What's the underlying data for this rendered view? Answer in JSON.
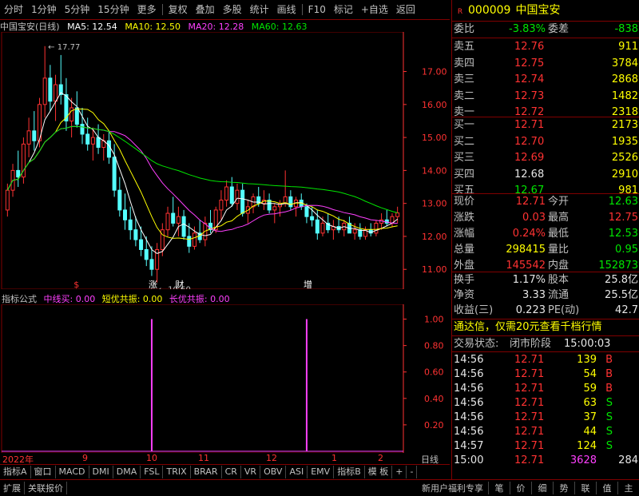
{
  "toolbar": {
    "items": [
      "分时",
      "1分钟",
      "5分钟",
      "15分钟",
      "更多",
      "复权",
      "叠加",
      "多股",
      "统计",
      "画线",
      "F10",
      "标记",
      "+自选",
      "返回"
    ]
  },
  "header": {
    "stock_title": "中国宝安(日线)",
    "ma5": "MA5: 12.54",
    "ma10": "MA10: 12.50",
    "ma20": "MA20: 12.28",
    "ma60": "MA60: 12.63",
    "high_label": "17.77",
    "low_label": "10.60"
  },
  "colors": {
    "up": "#ff3232",
    "down": "#54ffff",
    "ma5": "#ffffff",
    "ma10": "#ffff00",
    "ma20": "#ff40ff",
    "ma60": "#00e600",
    "axis": "#ff3232",
    "grid": "#800000"
  },
  "event_marks": [
    {
      "text": "$",
      "color": "#ff3232"
    },
    {
      "text": "涨",
      "color": "#ffffff"
    },
    {
      "text": "财",
      "color": "#ffffff"
    },
    {
      "text": "增",
      "color": "#ffffff"
    }
  ],
  "indicator": {
    "name": "指标公式",
    "line1": "中线买: 0.00",
    "line2": "短优共振: 0.00",
    "line3": "长优共振: 0.00"
  },
  "dates": [
    "2022年",
    "9",
    "10",
    "11",
    "12",
    "1",
    "2"
  ],
  "period_label": "日线",
  "tabs": [
    "指标A",
    "窗口",
    "MACD",
    "DMI",
    "DMA",
    "FSL",
    "TRIX",
    "BRAR",
    "CR",
    "VR",
    "OBV",
    "ASI",
    "EMV",
    "指标B",
    "模 板",
    "+",
    "-"
  ],
  "bottom": {
    "left": [
      "扩展",
      "关联报价"
    ],
    "center": "新用户福利专享",
    "right": [
      "笔",
      "价",
      "细",
      "势",
      "联",
      "值",
      "主"
    ]
  },
  "chart_data": [
    {
      "type": "candlestick",
      "title": "中国宝安(日线)",
      "ylim": [
        10.4,
        18.2
      ],
      "y_ticks": [
        11.0,
        12.0,
        13.0,
        14.0,
        15.0,
        16.0,
        17.0
      ],
      "series_ma": [
        {
          "name": "MA5",
          "value": 12.54
        },
        {
          "name": "MA10",
          "value": 12.5
        },
        {
          "name": "MA20",
          "value": 12.28
        },
        {
          "name": "MA60",
          "value": 12.63
        }
      ],
      "candles": [
        [
          12.8,
          13.6,
          12.6,
          13.4
        ],
        [
          13.4,
          14.2,
          13.2,
          14.0
        ],
        [
          14.0,
          14.6,
          13.5,
          13.8
        ],
        [
          13.8,
          15.0,
          13.6,
          14.8
        ],
        [
          14.8,
          15.6,
          14.4,
          15.2
        ],
        [
          15.2,
          15.8,
          14.6,
          14.9
        ],
        [
          14.9,
          16.2,
          14.7,
          16.0
        ],
        [
          16.0,
          17.77,
          15.6,
          16.8
        ],
        [
          16.8,
          17.2,
          15.8,
          16.1
        ],
        [
          16.1,
          16.9,
          15.5,
          16.6
        ],
        [
          16.6,
          17.5,
          16.0,
          16.3
        ],
        [
          16.3,
          16.8,
          15.2,
          15.5
        ],
        [
          15.5,
          16.2,
          15.0,
          15.9
        ],
        [
          15.9,
          16.4,
          15.3,
          15.4
        ],
        [
          15.4,
          15.9,
          14.8,
          15.1
        ],
        [
          15.1,
          15.6,
          14.6,
          14.8
        ],
        [
          14.8,
          15.3,
          14.3,
          15.0
        ],
        [
          15.0,
          15.4,
          14.5,
          14.7
        ],
        [
          14.7,
          15.1,
          14.3,
          14.9
        ],
        [
          14.9,
          15.2,
          14.2,
          14.4
        ],
        [
          14.4,
          14.8,
          13.2,
          13.4
        ],
        [
          13.4,
          13.8,
          12.6,
          12.8
        ],
        [
          12.8,
          13.3,
          12.2,
          12.5
        ],
        [
          12.5,
          12.9,
          11.9,
          12.2
        ],
        [
          12.2,
          12.6,
          11.7,
          11.9
        ],
        [
          11.9,
          12.3,
          11.4,
          11.6
        ],
        [
          11.6,
          12.0,
          11.1,
          11.3
        ],
        [
          11.3,
          11.7,
          10.8,
          11.0
        ],
        [
          11.0,
          11.8,
          10.6,
          11.6
        ],
        [
          11.6,
          12.4,
          11.4,
          12.2
        ],
        [
          12.2,
          12.9,
          12.0,
          12.7
        ],
        [
          12.7,
          13.2,
          12.3,
          12.4
        ],
        [
          12.4,
          12.9,
          12.0,
          12.6
        ],
        [
          12.6,
          12.8,
          11.9,
          12.0
        ],
        [
          12.0,
          12.4,
          11.5,
          11.7
        ],
        [
          11.7,
          12.3,
          11.6,
          12.1
        ],
        [
          12.1,
          12.5,
          11.8,
          11.9
        ],
        [
          11.9,
          12.6,
          11.7,
          12.4
        ],
        [
          12.4,
          12.8,
          12.1,
          12.2
        ],
        [
          12.2,
          12.9,
          12.1,
          12.8
        ],
        [
          12.8,
          13.4,
          12.5,
          13.1
        ],
        [
          13.1,
          13.7,
          12.9,
          13.5
        ],
        [
          13.5,
          13.8,
          12.9,
          13.0
        ],
        [
          13.0,
          13.6,
          12.8,
          13.4
        ],
        [
          13.4,
          13.6,
          12.6,
          12.7
        ],
        [
          12.7,
          13.1,
          12.4,
          12.9
        ],
        [
          12.9,
          13.3,
          12.7,
          13.2
        ],
        [
          13.2,
          13.5,
          12.9,
          13.0
        ],
        [
          13.0,
          13.4,
          12.8,
          13.1
        ],
        [
          13.1,
          13.3,
          12.7,
          12.8
        ],
        [
          12.8,
          13.0,
          12.4,
          12.9
        ],
        [
          12.9,
          13.1,
          12.6,
          13.0
        ],
        [
          13.0,
          14.0,
          12.9,
          13.2
        ],
        [
          13.2,
          13.4,
          12.8,
          12.9
        ],
        [
          12.9,
          13.2,
          12.6,
          13.1
        ],
        [
          13.1,
          13.3,
          12.8,
          12.9
        ],
        [
          12.9,
          13.0,
          12.4,
          12.6
        ],
        [
          12.6,
          12.9,
          12.3,
          12.5
        ],
        [
          12.5,
          12.8,
          11.9,
          12.1
        ],
        [
          12.1,
          12.6,
          12.0,
          12.4
        ],
        [
          12.4,
          12.7,
          12.1,
          12.2
        ],
        [
          12.2,
          12.5,
          11.9,
          12.3
        ],
        [
          12.3,
          12.6,
          12.1,
          12.2
        ],
        [
          12.2,
          12.5,
          12.0,
          12.4
        ],
        [
          12.4,
          12.6,
          12.1,
          12.1
        ],
        [
          12.1,
          12.4,
          11.9,
          12.2
        ],
        [
          12.2,
          12.4,
          11.9,
          12.0
        ],
        [
          12.0,
          12.3,
          11.9,
          12.2
        ],
        [
          12.2,
          12.4,
          12.0,
          12.1
        ],
        [
          12.1,
          12.5,
          12.0,
          12.4
        ],
        [
          12.4,
          12.7,
          12.2,
          12.5
        ],
        [
          12.5,
          12.8,
          12.3,
          12.4
        ],
        [
          12.4,
          12.7,
          12.3,
          12.6
        ],
        [
          12.6,
          12.9,
          12.4,
          12.71
        ]
      ]
    },
    {
      "type": "line",
      "title": "指标公式",
      "ylim": [
        0,
        1.1
      ],
      "y_ticks": [
        0.2,
        0.4,
        0.6,
        0.8,
        1.0
      ],
      "spikes_at_index": [
        27,
        56
      ],
      "spike_value": 1.0,
      "color": "#ff40ff"
    }
  ],
  "quote": {
    "code": "000009",
    "name": "中国宝安",
    "weibi_label": "委比",
    "weibi": "-3.83%",
    "weicha_label": "委差",
    "weicha": "-838",
    "asks": [
      {
        "label": "卖五",
        "price": "12.76",
        "vol": "911"
      },
      {
        "label": "卖四",
        "price": "12.75",
        "vol": "3784"
      },
      {
        "label": "卖三",
        "price": "12.74",
        "vol": "2868"
      },
      {
        "label": "卖二",
        "price": "12.73",
        "vol": "1482"
      },
      {
        "label": "卖一",
        "price": "12.72",
        "vol": "2318"
      }
    ],
    "bids": [
      {
        "label": "买一",
        "price": "12.71",
        "vol": "2173"
      },
      {
        "label": "买二",
        "price": "12.70",
        "vol": "1935"
      },
      {
        "label": "买三",
        "price": "12.69",
        "vol": "2526"
      },
      {
        "label": "买四",
        "price": "12.68",
        "vol": "2910"
      },
      {
        "label": "买五",
        "price": "12.67",
        "vol": "981"
      }
    ],
    "stats": [
      {
        "l1": "现价",
        "v1": "12.71",
        "c1": "red",
        "l2": "今开",
        "v2": "12.63",
        "c2": "green"
      },
      {
        "l1": "涨跌",
        "v1": "0.03",
        "c1": "red",
        "l2": "最高",
        "v2": "12.75",
        "c2": "red"
      },
      {
        "l1": "涨幅",
        "v1": "0.24%",
        "c1": "red",
        "l2": "最低",
        "v2": "12.53",
        "c2": "green"
      },
      {
        "l1": "总量",
        "v1": "298415",
        "c1": "yellow",
        "l2": "量比",
        "v2": "0.95",
        "c2": "green"
      },
      {
        "l1": "外盘",
        "v1": "145542",
        "c1": "red",
        "l2": "内盘",
        "v2": "152873",
        "c2": "green"
      }
    ],
    "stats2": [
      {
        "l1": "换手",
        "v1": "1.17%",
        "l2": "股本",
        "v2": "25.8亿"
      },
      {
        "l1": "净资",
        "v1": "3.33",
        "l2": "流通",
        "v2": "25.5亿"
      },
      {
        "l1": "收益(三)",
        "v1": "0.223",
        "l2": "PE(动)",
        "v2": "42.7"
      }
    ],
    "promo": "通达信，仅需20元查看千档行情",
    "trade_status_label": "交易状态:",
    "trade_status": "闭市阶段",
    "trade_time": "15:00:03",
    "ticks": [
      {
        "t": "14:56",
        "p": "12.71",
        "v": "139",
        "s": "B"
      },
      {
        "t": "14:56",
        "p": "12.71",
        "v": "54",
        "s": "B"
      },
      {
        "t": "14:56",
        "p": "12.71",
        "v": "59",
        "s": "B"
      },
      {
        "t": "14:56",
        "p": "12.71",
        "v": "63",
        "s": "S"
      },
      {
        "t": "14:56",
        "p": "12.71",
        "v": "37",
        "s": "S"
      },
      {
        "t": "14:56",
        "p": "12.71",
        "v": "44",
        "s": "S"
      },
      {
        "t": "14:57",
        "p": "12.71",
        "v": "124",
        "s": "S"
      },
      {
        "t": "15:00",
        "p": "12.71",
        "v": "3628",
        "s": "284"
      }
    ]
  }
}
